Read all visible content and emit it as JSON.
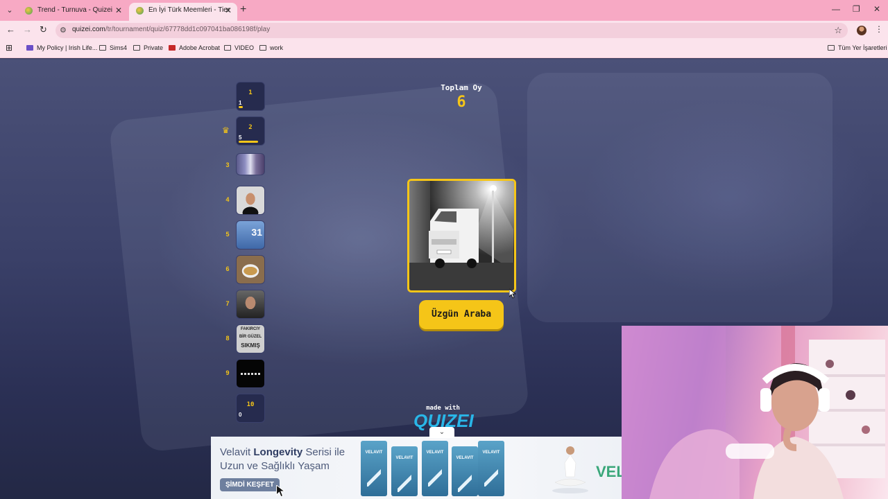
{
  "browser": {
    "tabs": [
      {
        "title": "Trend - Turnuva - Quizei",
        "active": false
      },
      {
        "title": "En İyi Türk Meemleri - Tier List...",
        "active": true
      }
    ],
    "url_host": "quizei.com",
    "url_path": "/tr/tournament/quiz/67778dd1c097041ba086198f/play",
    "bookmarks": [
      "My Policy | Irish Life...",
      "Sims4",
      "Private",
      "Adobe Acrobat",
      "VIDEO",
      "work"
    ],
    "all_bookmarks": "Tüm Yer İşaretleri"
  },
  "quiz": {
    "total_label": "Toplam Oy",
    "total_value": "6",
    "current_item": "Üzgün Araba",
    "ranks": [
      {
        "pos": "1",
        "card_label": "1",
        "votes": "1",
        "bar": 0.17,
        "crown": false
      },
      {
        "pos": "2",
        "card_label": "2",
        "votes": "5",
        "bar": 0.83,
        "crown": true
      },
      {
        "pos": "3"
      },
      {
        "pos": "4"
      },
      {
        "pos": "5"
      },
      {
        "pos": "6"
      },
      {
        "pos": "7"
      },
      {
        "pos": "8"
      },
      {
        "pos": "9"
      },
      {
        "pos": "10",
        "card_label": "10",
        "votes": "0",
        "bar": 0
      }
    ],
    "thumb_texts": {
      "five": "31",
      "eight_top": "FAKIRCIY",
      "eight_mid": "BİR GÜZEL",
      "eight_bot": "SIKMIŞ"
    },
    "made_with": "made with",
    "logo": "QUIZEI"
  },
  "ad": {
    "line1_a": "Velavit ",
    "line1_b": "Longevity",
    "line1_c": " Serisi ile",
    "line2": "Uzun ve Sağlıklı Yaşam",
    "cta": "ŞİMDİ KEŞFET",
    "brand": "VEL",
    "products": [
      "VELAVIT",
      "VELAVIT",
      "VELAVIT",
      "VELAVIT",
      "VELAVIT"
    ]
  },
  "colors": {
    "accent": "#f5c518",
    "logo": "#29b6e8",
    "tabbar": "#f7a9c4"
  }
}
